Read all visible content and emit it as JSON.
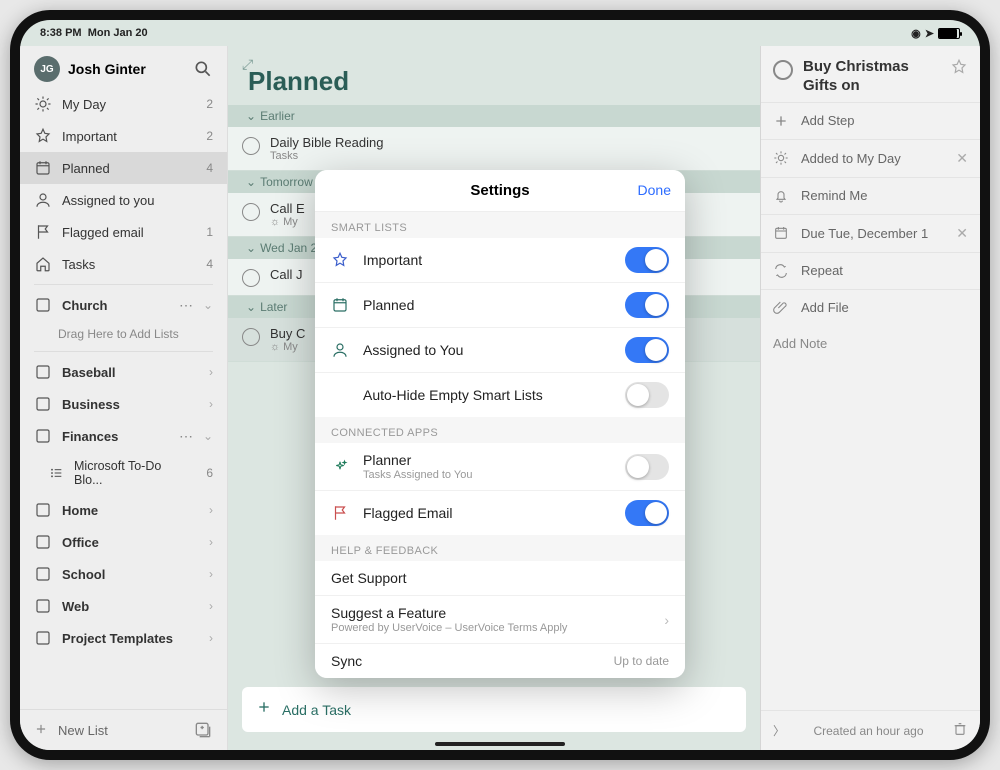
{
  "status": {
    "time": "8:38 PM",
    "date": "Mon Jan 20"
  },
  "user": {
    "initials": "JG",
    "name": "Josh Ginter"
  },
  "sidebar": {
    "smart": [
      {
        "icon": "sun",
        "label": "My Day",
        "count": "2"
      },
      {
        "icon": "star",
        "label": "Important",
        "count": "2"
      },
      {
        "icon": "calendar",
        "label": "Planned",
        "count": "4",
        "selected": true
      },
      {
        "icon": "person",
        "label": "Assigned to you",
        "count": ""
      },
      {
        "icon": "flag",
        "label": "Flagged email",
        "count": "1"
      },
      {
        "icon": "home",
        "label": "Tasks",
        "count": "4"
      }
    ],
    "church": {
      "label": "Church",
      "hint": "Drag Here to Add Lists"
    },
    "lists": [
      {
        "label": "Baseball"
      },
      {
        "label": "Business"
      }
    ],
    "finances": {
      "label": "Finances",
      "child": {
        "label": "Microsoft To-Do Blo...",
        "count": "6"
      }
    },
    "more": [
      {
        "label": "Home"
      },
      {
        "label": "Office"
      },
      {
        "label": "School"
      },
      {
        "label": "Web"
      },
      {
        "label": "Project Templates"
      }
    ],
    "newlist": "New List"
  },
  "main": {
    "title": "Planned",
    "groups": [
      {
        "label": "Earlier",
        "open": true,
        "tasks": [
          {
            "title": "Daily Bible Reading",
            "sub": "Tasks"
          }
        ]
      },
      {
        "label": "Tomorrow",
        "open": true,
        "tasks": [
          {
            "title": "Call E",
            "sub": "☼ My"
          }
        ]
      },
      {
        "label": "Wed Jan 2",
        "open": true,
        "tasks": [
          {
            "title": "Call J",
            "sub": " "
          }
        ]
      },
      {
        "label": "Later",
        "open": true,
        "tasks": [
          {
            "title": "Buy C",
            "sub": "☼ My",
            "selected": true
          }
        ]
      }
    ],
    "addtask": "Add a Task"
  },
  "detail": {
    "title": "Buy Christmas Gifts on",
    "addstep": "Add Step",
    "myday": "Added to My Day",
    "remind": "Remind Me",
    "due": "Due Tue, December 1",
    "repeat": "Repeat",
    "addfile": "Add File",
    "addnote": "Add Note",
    "footer": "Created an hour ago"
  },
  "settings": {
    "title": "Settings",
    "done": "Done",
    "section_smart": "SMART LISTS",
    "rows_smart": [
      {
        "icon": "star",
        "label": "Important",
        "on": true,
        "color": "#3b5ecb"
      },
      {
        "icon": "calendar",
        "label": "Planned",
        "on": true,
        "color": "#2a6e64"
      },
      {
        "icon": "person",
        "label": "Assigned to You",
        "on": true,
        "color": "#2a6e64"
      },
      {
        "icon": "",
        "label": "Auto-Hide Empty Smart Lists",
        "on": false
      }
    ],
    "section_apps": "CONNECTED APPS",
    "rows_apps": [
      {
        "icon": "spark",
        "label": "Planner",
        "sub": "Tasks Assigned to You",
        "on": false,
        "color": "#1d7a5a"
      },
      {
        "icon": "flag",
        "label": "Flagged Email",
        "on": true,
        "color": "#c94e4e"
      }
    ],
    "section_help": "HELP & FEEDBACK",
    "help_support": "Get Support",
    "help_suggest": {
      "label": "Suggest a Feature",
      "sub": "Powered by UserVoice – UserVoice Terms Apply"
    },
    "sync": {
      "label": "Sync",
      "meta": "Up to date"
    }
  }
}
